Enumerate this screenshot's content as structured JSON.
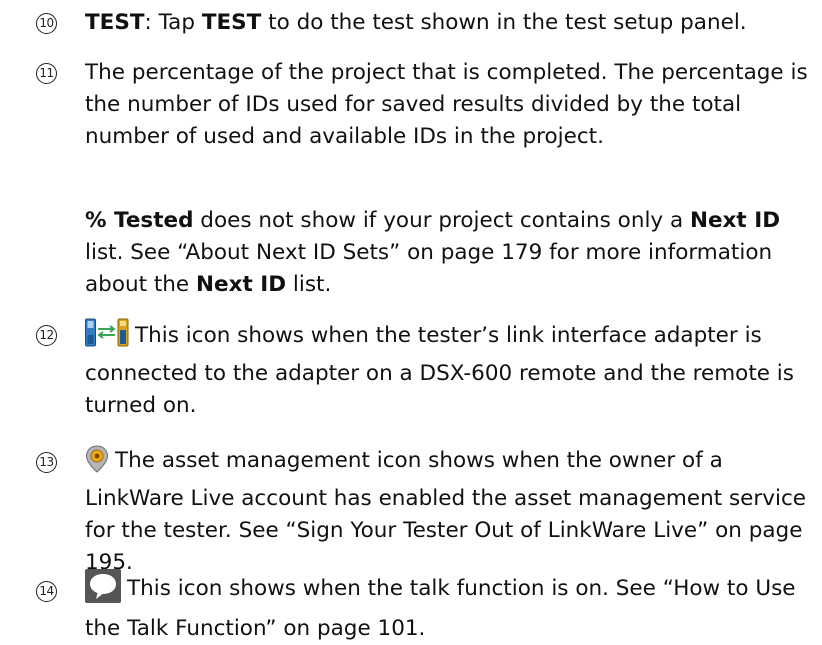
{
  "items": [
    {
      "number": "10",
      "bold_label": "TEST",
      "text_a": ": Tap ",
      "bold_b": "TEST",
      "text_c": " to do the test shown in the test setup panel."
    },
    {
      "number": "11",
      "text": "The percentage of the project that is completed. The percentage is the number of IDs used for saved results divided by the total number of used and available IDs in the project.",
      "sub_paragraph": {
        "bold_a": "% Tested",
        "text_b": " does not show if your project contains only a ",
        "bold_c": "Next ID",
        "text_d": " list. See “About Next ID Sets” on page 179 for more information about the ",
        "bold_e": "Next ID",
        "text_f": " list."
      }
    },
    {
      "number": "12",
      "icon": "remote-link-icon",
      "text": "This icon shows when the tester’s link interface adapter is connected to the adapter on a DSX-600 remote and the remote is turned on."
    },
    {
      "number": "13",
      "icon": "asset-management-icon",
      "text": "The asset management icon shows when the owner of a LinkWare Live account has enabled the asset management service for the tester. See “Sign Your Tester Out of LinkWare Live” on page 195."
    },
    {
      "number": "14",
      "icon": "talk-icon",
      "text": "This icon shows when the talk function is on. See “How to Use the Talk Function” on page 101."
    }
  ],
  "colors": {
    "text": "#111111",
    "adapter_blue": "#2f7fc8",
    "adapter_gold": "#d9a21a",
    "arrows_green": "#3aa655",
    "talk_gray": "#555555"
  }
}
